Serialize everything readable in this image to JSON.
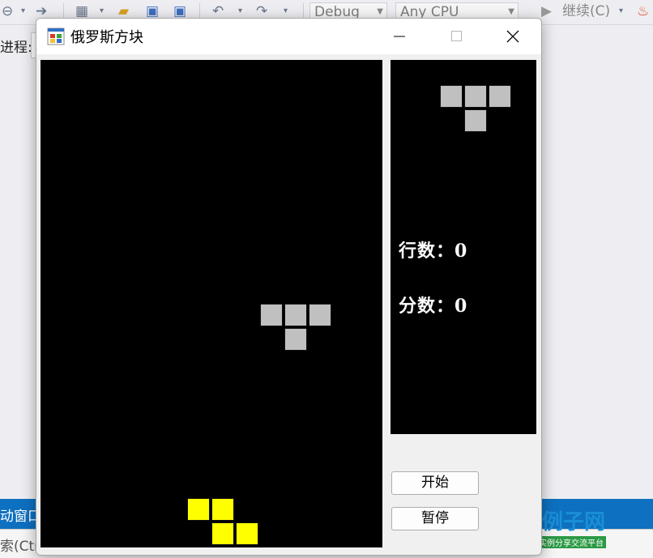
{
  "ide": {
    "config": "Debug",
    "platform": "Any CPU",
    "continue_label": "继续(C)",
    "left_label": "进程:",
    "bottom_panel_label": "动窗口",
    "bottom_search": "索(Ctrl"
  },
  "watermark": {
    "brand": "好例子网",
    "slogan": "开发实例分享交流平台"
  },
  "window": {
    "title": "俄罗斯方块",
    "colors": {
      "board": "#000000",
      "falling_piece": "#c0c0c0",
      "landed_piece": "#ffff00"
    }
  },
  "next_piece": {
    "shape": "T",
    "color": "#c0c0c0"
  },
  "stats": {
    "lines_label": "行数：0",
    "score_label": "分数：0"
  },
  "buttons": {
    "start": "开始",
    "pause": "暂停"
  }
}
